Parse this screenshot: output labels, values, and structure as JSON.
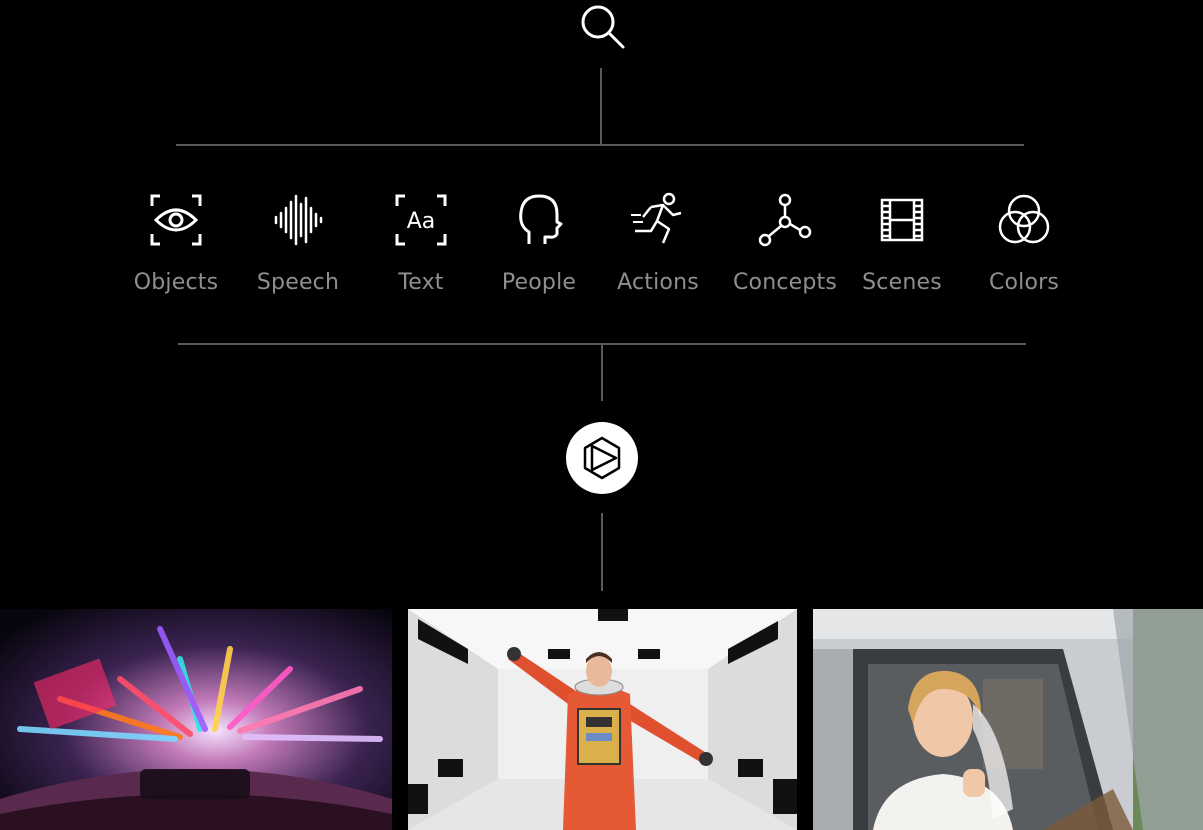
{
  "categories": [
    {
      "label": "Objects",
      "icon": "eye-icon"
    },
    {
      "label": "Speech",
      "icon": "waveform-icon"
    },
    {
      "label": "Text",
      "icon": "text-aa-icon"
    },
    {
      "label": "People",
      "icon": "head-profile-icon"
    },
    {
      "label": "Actions",
      "icon": "running-person-icon"
    },
    {
      "label": "Concepts",
      "icon": "node-graph-icon"
    },
    {
      "label": "Scenes",
      "icon": "film-strip-icon"
    },
    {
      "label": "Colors",
      "icon": "color-circles-icon"
    }
  ],
  "search": {
    "icon": "search-icon"
  },
  "logo": {
    "icon": "play-hexagon-logo-icon"
  },
  "thumbnails": [
    {
      "name": "neon-city-night-drive"
    },
    {
      "name": "astronaut-orange-suit-corridor"
    },
    {
      "name": "bride-in-car-window"
    }
  ],
  "colors": {
    "background": "#000000",
    "line": "#5a5a5a",
    "label": "#8f8f8f",
    "icon": "#ffffff"
  }
}
